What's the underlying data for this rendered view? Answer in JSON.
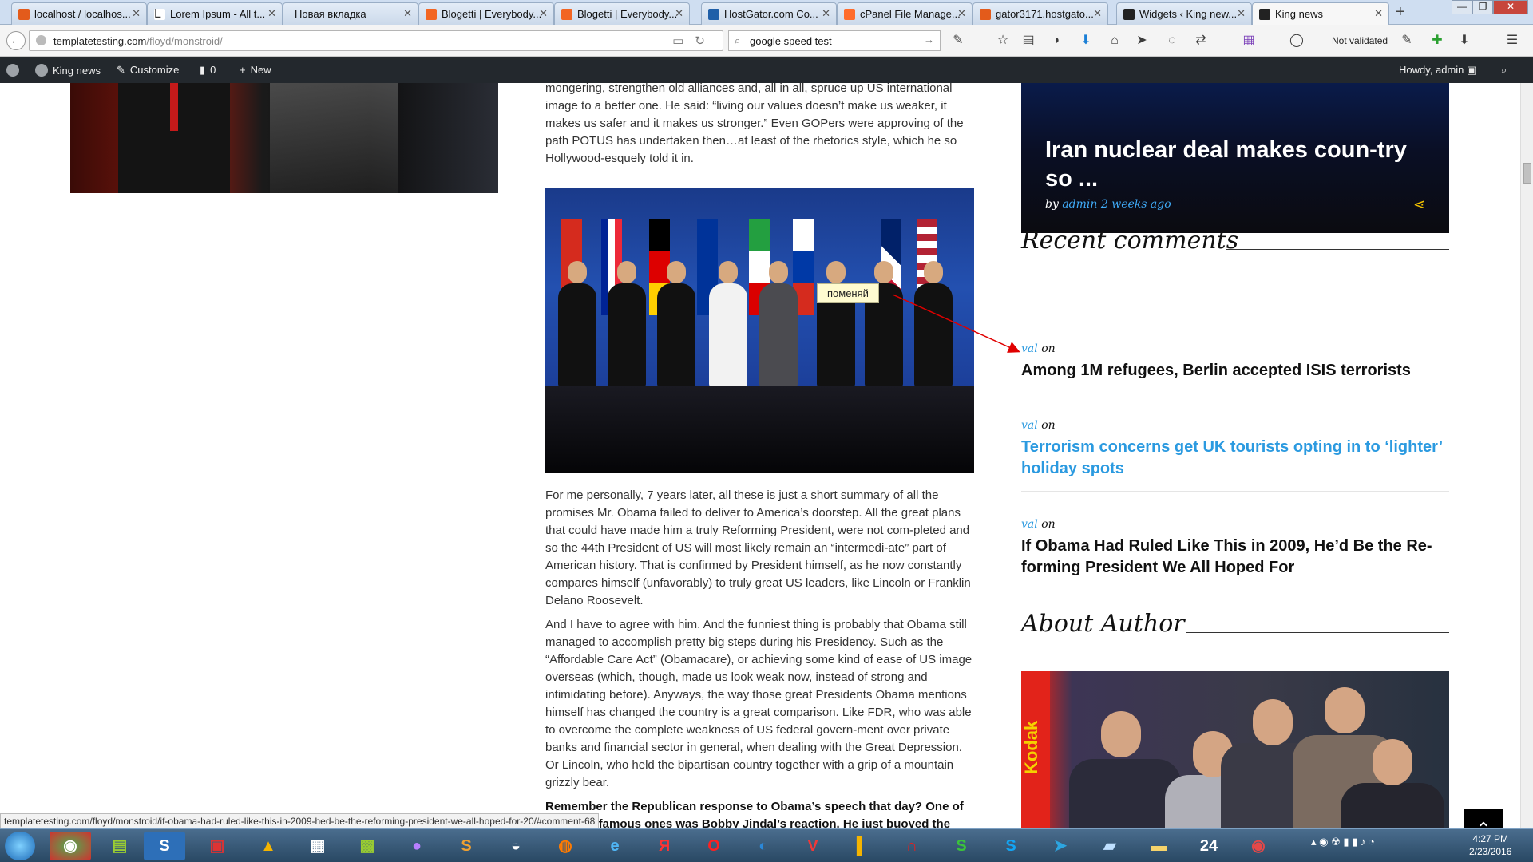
{
  "browser": {
    "tabs": [
      {
        "title": "localhost / localhos...",
        "color": "#e35b1b"
      },
      {
        "title": "Lorem Ipsum - All t...",
        "color": "#888888"
      },
      {
        "title": "Новая вкладка",
        "color": ""
      },
      {
        "title": "Blogetti | Everybody...",
        "color": "#f26522"
      },
      {
        "title": "Blogetti | Everybody...",
        "color": "#f26522"
      },
      {
        "title": "HostGator.com Co...",
        "color": "#1f5fa8"
      },
      {
        "title": "cPanel File Manage...",
        "color": "#ff6c2c"
      },
      {
        "title": "gator3171.hostgato...",
        "color": "#e35b1b"
      },
      {
        "title": "Widgets ‹ King new...",
        "color": "#222222"
      },
      {
        "title": "King news",
        "color": "#222222"
      }
    ],
    "url_host": "templatetesting.com",
    "url_path": "/floyd/monstroid/",
    "search_value": "google speed test",
    "not_validated": "Not validated",
    "new_tab": "+"
  },
  "adminbar": {
    "site_name": "King news",
    "customize": "Customize",
    "comments_count": "0",
    "new_label": "New",
    "howdy": "Howdy, admin"
  },
  "article": {
    "para_top": "mongering, strengthen old alliances and, all in all, spruce up US international image to a better one. He said: “living our values doesn’t make us weaker, it makes us safer and it makes us stronger.” Even GOPers were approving of the path POTUS has undertaken then…at least of the rhetorics style, which he so Hollywood-esquely told it in.",
    "para_1": "For me personally, 7 years later, all these is just a short summary of all the promises Mr. Obama failed to deliver to America’s doorstep. All the great plans that could have made him a truly Reforming President, were not com-pleted and so the 44th President of US will most likely remain an “intermedi-ate” part of American history. That is confirmed by President himself, as he now constantly compares himself (unfavorably) to truly great US leaders, like Lincoln or Franklin Delano Roosevelt.",
    "para_2": "And I have to agree with him. And the funniest thing is probably that Obama still managed to accomplish pretty big steps during his Presidency. Such as the “Affordable Care Act” (Obamacare), or achieving some kind of ease of US image overseas (which, though, made us look weak now, instead of strong and intimidating before). Anyways, the way those great Presidents Obama mentions himself has changed the country is a great comparison. Like FDR, who was able to overcome the complete weakness of US federal govern-ment over private banks and financial sector in general, when dealing with the Great Depression. Or Lincoln, who held the bipartisan country together with a grip of a mountain grizzly bear.",
    "para_3_bold": "Remember the Republican response to Obama’s speech that day? One of",
    "para_3_rest": "the most famous ones was Bobby Jindal’s reaction. He just buoyed the",
    "photo_tooltip": "поменяй"
  },
  "sidebar": {
    "featured_title": "Iran nuclear deal makes coun-try so ...",
    "featured_by": "by",
    "featured_author": "admin",
    "featured_time": "2 weeks ago",
    "recent_comments_title": "Recent comments",
    "comments": [
      {
        "author": "val",
        "on": "on",
        "post": "Among 1M refugees, Berlin accepted ISIS terrorists"
      },
      {
        "author": "val",
        "on": "on",
        "post": "Terrorism concerns get UK tourists opting in to ‘lighter’ holiday spots"
      },
      {
        "author": "val",
        "on": "on",
        "post": "If Obama Had Ruled Like This in 2009, He’d Be the Re-forming President We All Hoped For"
      }
    ],
    "about_title": "About Author",
    "kodak_text": "Kodak"
  },
  "status_url": "templatetesting.com/floyd/monstroid/if-obama-had-ruled-like-this-in-2009-hed-be-the-reforming-president-we-all-hoped-for-20/#comment-68",
  "taskbar": {
    "time": "4:27 PM",
    "date": "2/23/2016",
    "badge": "24"
  },
  "colors": {
    "link_blue": "#2b9ae0",
    "admin_bar": "#23282d",
    "share_yellow": "#f2c200"
  }
}
